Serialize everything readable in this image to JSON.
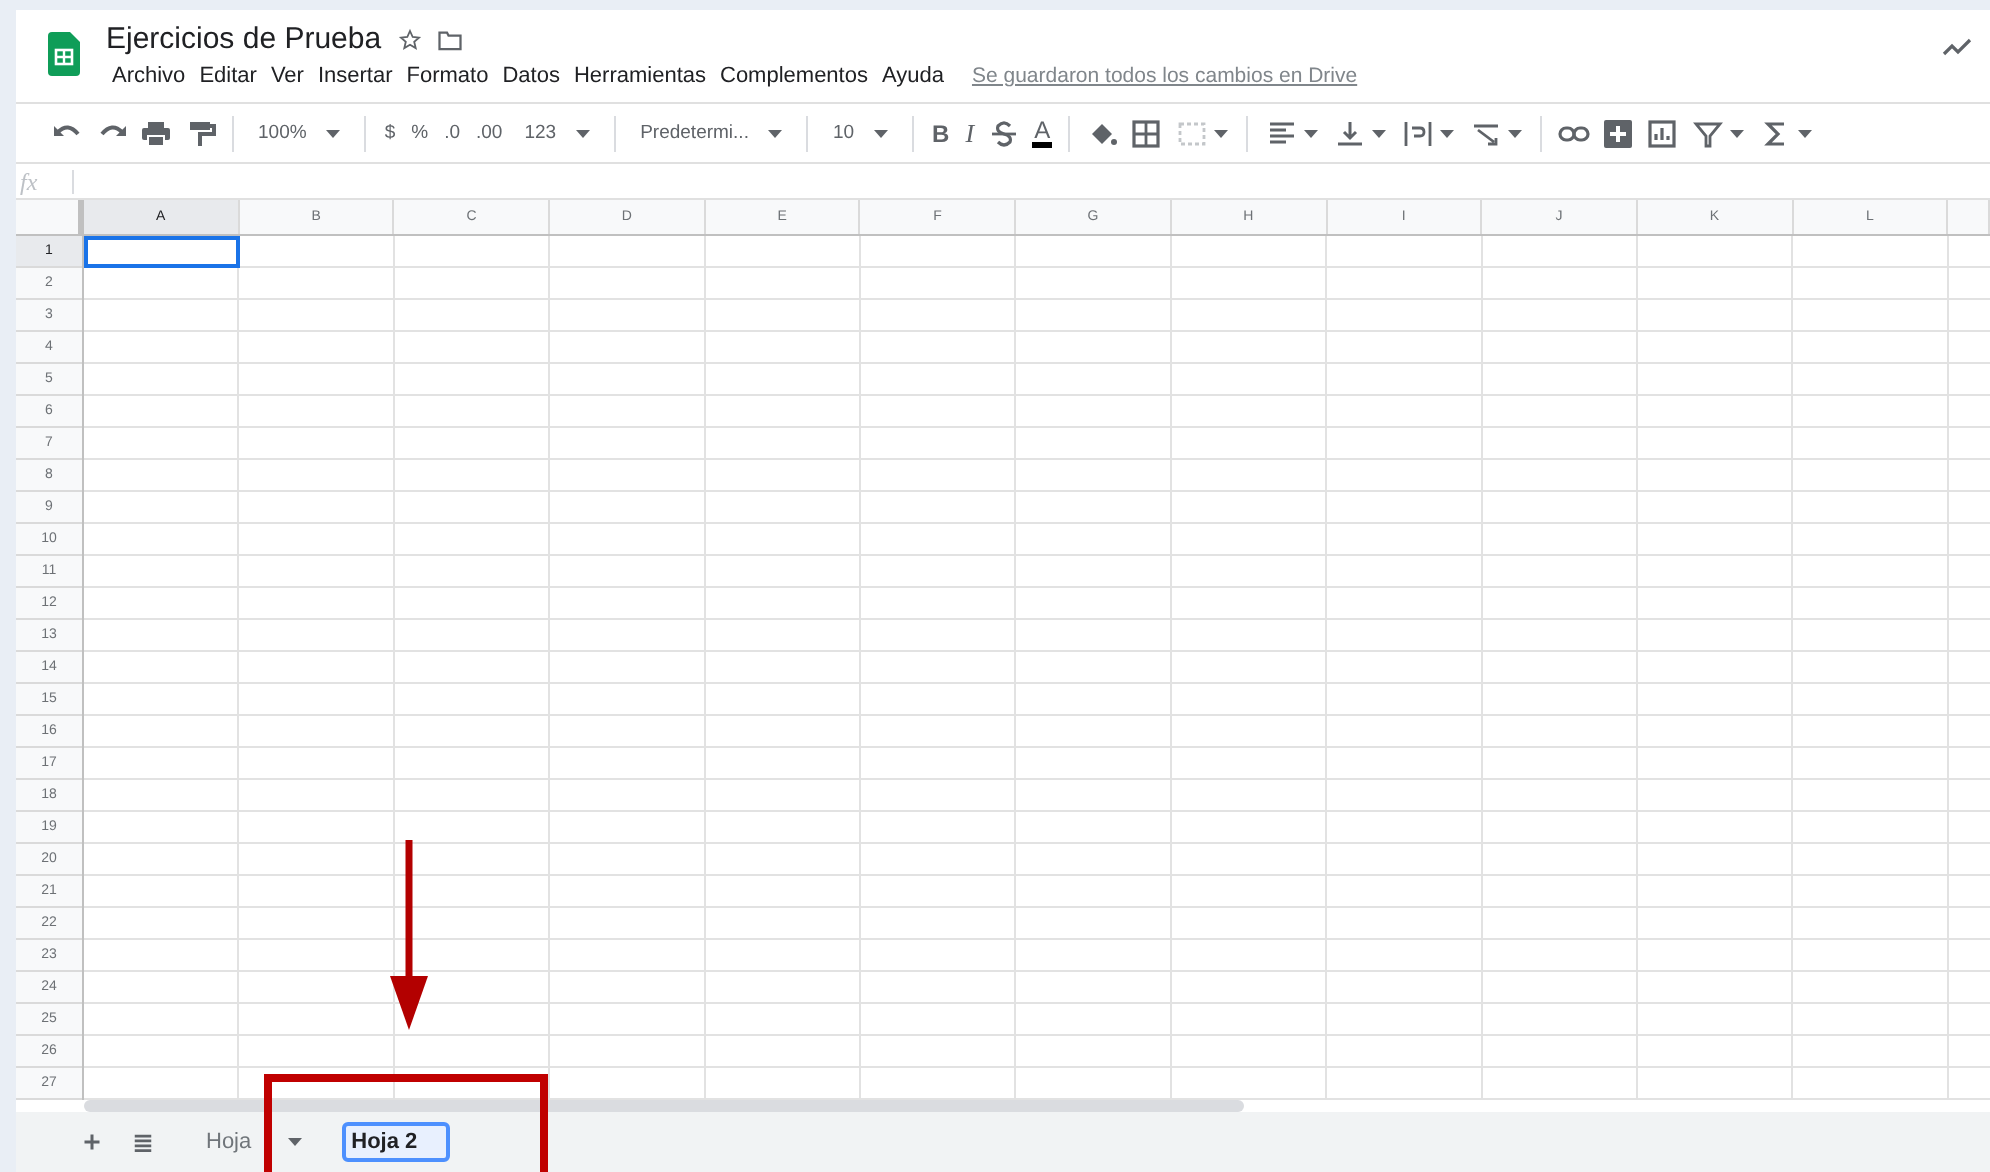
{
  "document": {
    "title": "Ejercicios de Prueba",
    "save_status": "Se guardaron todos los cambios en Drive"
  },
  "menu": [
    "Archivo",
    "Editar",
    "Ver",
    "Insertar",
    "Formato",
    "Datos",
    "Herramientas",
    "Complementos",
    "Ayuda"
  ],
  "toolbar": [
    {
      "kind": "icon"
    },
    {
      "kind": "icon"
    },
    {
      "kind": "icon"
    },
    {
      "kind": "icon"
    },
    {
      "kind": "separator"
    },
    {
      "kind": "text-menu",
      "label": "100%"
    },
    {
      "kind": "separator"
    },
    {
      "kind": "text",
      "label": "$"
    },
    {
      "kind": "text",
      "label": "%"
    },
    {
      "kind": "text",
      "label": ".0"
    },
    {
      "kind": "text",
      "label": ".00"
    },
    {
      "kind": "text-menu",
      "label": "123"
    },
    {
      "kind": "separator"
    },
    {
      "kind": "text-menu",
      "label": "Predetermi..."
    },
    {
      "kind": "separator"
    },
    {
      "kind": "text-menu",
      "label": "10"
    },
    {
      "kind": "separator"
    },
    {
      "kind": "text",
      "label": "B"
    },
    {
      "kind": "text",
      "label": "I"
    },
    {
      "kind": "icon"
    },
    {
      "kind": "text",
      "label": "A"
    },
    {
      "kind": "separator"
    },
    {
      "kind": "icon"
    },
    {
      "kind": "icon"
    },
    {
      "kind": "icon-menu"
    },
    {
      "kind": "separator"
    },
    {
      "kind": "icon-menu"
    },
    {
      "kind": "icon-menu"
    },
    {
      "kind": "icon-menu"
    },
    {
      "kind": "icon-menu"
    },
    {
      "kind": "separator"
    },
    {
      "kind": "icon"
    },
    {
      "kind": "icon"
    },
    {
      "kind": "icon"
    },
    {
      "kind": "icon-menu"
    },
    {
      "kind": "icon-menu"
    }
  ],
  "formula_bar": {
    "label": "fx"
  },
  "columns": [
    {
      "label": "A",
      "selected": true
    },
    {
      "label": "B",
      "selected": false
    },
    {
      "label": "C",
      "selected": false
    },
    {
      "label": "D",
      "selected": false
    },
    {
      "label": "E",
      "selected": false
    },
    {
      "label": "F",
      "selected": false
    },
    {
      "label": "G",
      "selected": false
    },
    {
      "label": "H",
      "selected": false
    },
    {
      "label": "I",
      "selected": false
    },
    {
      "label": "J",
      "selected": false
    },
    {
      "label": "K",
      "selected": false
    },
    {
      "label": "L",
      "selected": false
    }
  ],
  "rows": [
    {
      "label": "1",
      "selected": true
    },
    {
      "label": "2",
      "selected": false
    },
    {
      "label": "3",
      "selected": false
    },
    {
      "label": "4",
      "selected": false
    },
    {
      "label": "5",
      "selected": false
    },
    {
      "label": "6",
      "selected": false
    },
    {
      "label": "7",
      "selected": false
    },
    {
      "label": "8",
      "selected": false
    },
    {
      "label": "9",
      "selected": false
    },
    {
      "label": "10",
      "selected": false
    },
    {
      "label": "11",
      "selected": false
    },
    {
      "label": "12",
      "selected": false
    },
    {
      "label": "13",
      "selected": false
    },
    {
      "label": "14",
      "selected": false
    },
    {
      "label": "15",
      "selected": false
    },
    {
      "label": "16",
      "selected": false
    },
    {
      "label": "17",
      "selected": false
    },
    {
      "label": "18",
      "selected": false
    },
    {
      "label": "19",
      "selected": false
    },
    {
      "label": "20",
      "selected": false
    },
    {
      "label": "21",
      "selected": false
    },
    {
      "label": "22",
      "selected": false
    },
    {
      "label": "23",
      "selected": false
    },
    {
      "label": "24",
      "selected": false
    },
    {
      "label": "25",
      "selected": false
    },
    {
      "label": "26",
      "selected": false
    },
    {
      "label": "27",
      "selected": false
    }
  ],
  "sheet_tabs": [
    {
      "label": "Hoja",
      "editing": false
    },
    {
      "label": "Hoja 2",
      "editing": true
    }
  ]
}
